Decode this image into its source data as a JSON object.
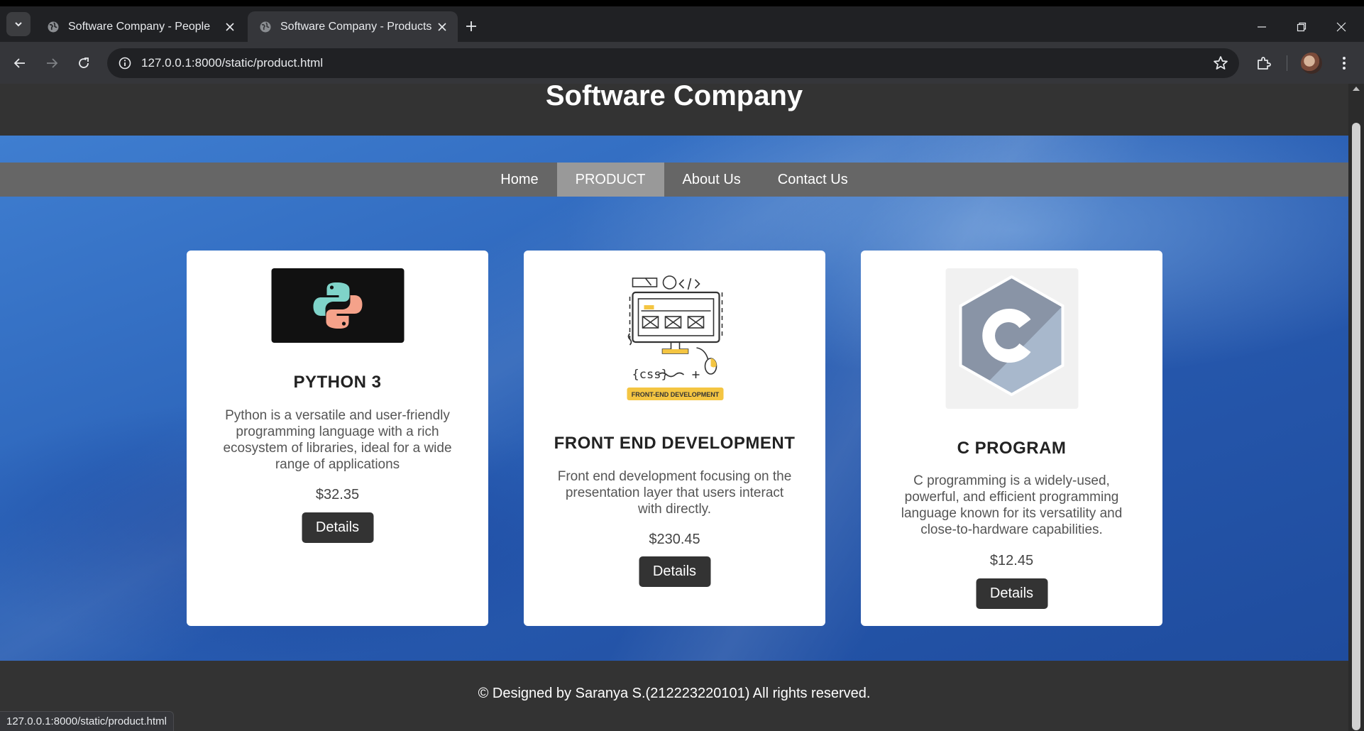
{
  "browser": {
    "tabs": [
      {
        "title": "Software Company - People",
        "active": false
      },
      {
        "title": "Software Company - Products",
        "active": true
      }
    ],
    "url_host": "127.0.0.1",
    "url_rest": ":8000/static/product.html",
    "status_url": "127.0.0.1:8000/static/product.html"
  },
  "site": {
    "title": "Software Company",
    "nav": [
      {
        "label": "Home",
        "active": false
      },
      {
        "label": "PRODUCT",
        "active": true
      },
      {
        "label": "About Us",
        "active": false
      },
      {
        "label": "Contact Us",
        "active": false
      }
    ],
    "products": [
      {
        "name": "PYTHON 3",
        "description": "Python is a versatile and user-friendly programming language with a rich ecosystem of libraries, ideal for a wide range of applications",
        "price": "$32.35",
        "button": "Details",
        "image_icon": "python-logo"
      },
      {
        "name": "FRONT END DEVELOPMENT",
        "description": "Front end development focusing on the presentation layer that users interact with directly.",
        "price": "$230.45",
        "button": "Details",
        "image_icon": "front-end-development-illustration",
        "image_caption": "FRONT-END DEVELOPMENT"
      },
      {
        "name": "C PROGRAM",
        "description": "C programming is a widely-used, powerful, and efficient programming language known for its versatility and close-to-hardware capabilities.",
        "price": "$12.45",
        "button": "Details",
        "image_icon": "c-language-logo"
      }
    ],
    "footer": "© Designed by Saranya S.(212223220101) All rights reserved."
  }
}
